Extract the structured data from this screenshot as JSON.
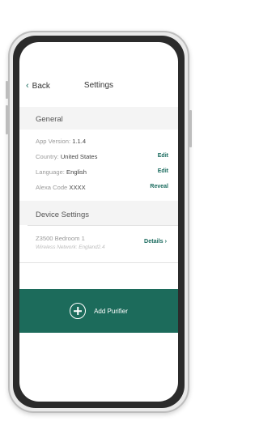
{
  "nav": {
    "back_label": "Back",
    "title": "Settings"
  },
  "general": {
    "header": "General",
    "rows": [
      {
        "label": "App Version:",
        "value": "1.1.4",
        "action": ""
      },
      {
        "label": "Country:",
        "value": "United States",
        "action": "Edit"
      },
      {
        "label": "Language:",
        "value": "English",
        "action": "Edit"
      },
      {
        "label": "Alexa Code",
        "value": "XXXX",
        "action": "Reveal"
      }
    ]
  },
  "device_settings": {
    "header": "Device Settings",
    "device": {
      "name": "Z3500 Bedroom 1",
      "network": "Wireless Network: England2.4",
      "details_label": "Details"
    }
  },
  "add_purifier": {
    "label": "Add Purifier"
  },
  "colors": {
    "accent": "#1c6b5b",
    "text": "#444444",
    "muted": "#9a9a9a"
  }
}
